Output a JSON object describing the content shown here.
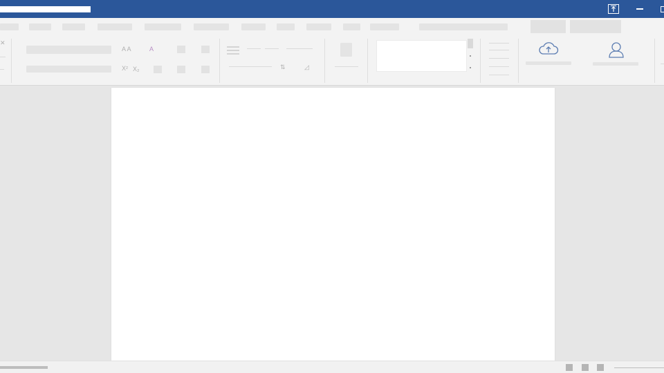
{
  "titlebar": {
    "color": "#2b579a",
    "icons": [
      "ribbon-display-options-icon",
      "minimize-icon",
      "restore-icon"
    ]
  },
  "ribbon": {
    "subscript_glyph": "X₂",
    "superscript_glyph": "X²",
    "font_size_glyphs": "A A",
    "clear_format_glyph": "A",
    "upload_icon": "cloud-upload-icon",
    "user_icon": "user-icon"
  },
  "document": {
    "page_color": "#ffffff"
  }
}
